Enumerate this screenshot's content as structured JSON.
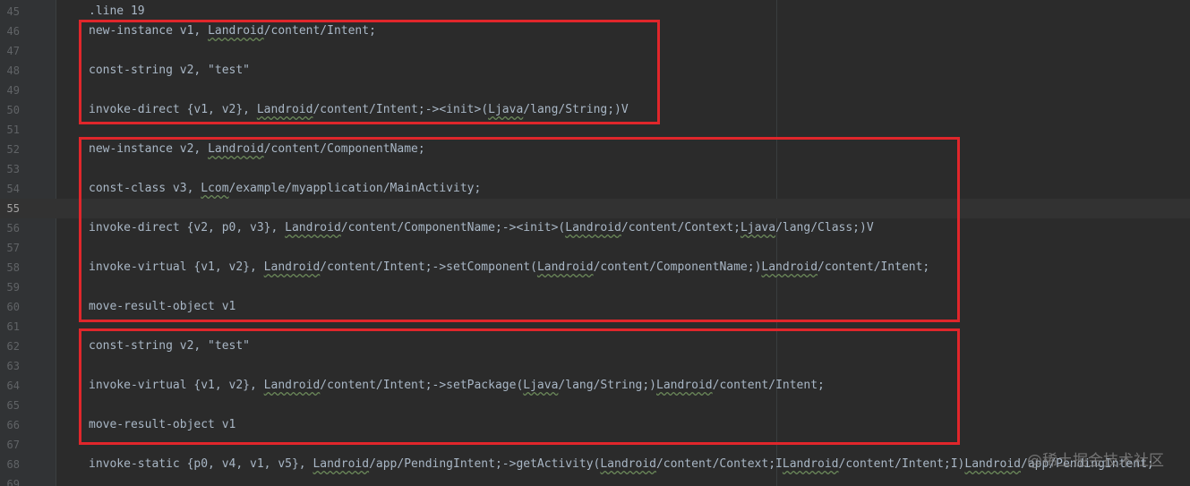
{
  "editor": {
    "lines": [
      {
        "num": "45",
        "parts": [
          {
            "t": ".line 19"
          }
        ]
      },
      {
        "num": "46",
        "parts": [
          {
            "t": "new-instance v1, "
          },
          {
            "t": "Landroid",
            "u": true
          },
          {
            "t": "/content/Intent;"
          }
        ]
      },
      {
        "num": "47",
        "parts": []
      },
      {
        "num": "48",
        "parts": [
          {
            "t": "const-string v2, \"test\""
          }
        ]
      },
      {
        "num": "49",
        "parts": []
      },
      {
        "num": "50",
        "parts": [
          {
            "t": "invoke-direct {v1, v2}, "
          },
          {
            "t": "Landroid",
            "u": true
          },
          {
            "t": "/content/Intent;->"
          },
          {
            "t": "<init>"
          },
          {
            "t": "("
          },
          {
            "t": "Ljava",
            "u": true
          },
          {
            "t": "/lang/String;)V"
          }
        ]
      },
      {
        "num": "51",
        "parts": []
      },
      {
        "num": "52",
        "parts": [
          {
            "t": "new-instance v2, "
          },
          {
            "t": "Landroid",
            "u": true
          },
          {
            "t": "/content/ComponentName;"
          }
        ]
      },
      {
        "num": "53",
        "parts": []
      },
      {
        "num": "54",
        "parts": [
          {
            "t": "const-class v3, "
          },
          {
            "t": "Lcom",
            "u": true
          },
          {
            "t": "/example/myapplication/MainActivity;"
          }
        ]
      },
      {
        "num": "55",
        "parts": [],
        "current": true
      },
      {
        "num": "56",
        "parts": [
          {
            "t": "invoke-direct {v2, p0, v3}, "
          },
          {
            "t": "Landroid",
            "u": true
          },
          {
            "t": "/content/ComponentName;->"
          },
          {
            "t": "<init>"
          },
          {
            "t": "("
          },
          {
            "t": "Landroid",
            "u": true
          },
          {
            "t": "/content/Context;"
          },
          {
            "t": "Ljava",
            "u": true
          },
          {
            "t": "/lang/Class;)V"
          }
        ]
      },
      {
        "num": "57",
        "parts": []
      },
      {
        "num": "58",
        "parts": [
          {
            "t": "invoke-virtual {v1, v2}, "
          },
          {
            "t": "Landroid",
            "u": true
          },
          {
            "t": "/content/Intent;->setComponent("
          },
          {
            "t": "Landroid",
            "u": true
          },
          {
            "t": "/content/ComponentName;)"
          },
          {
            "t": "Landroid",
            "u": true
          },
          {
            "t": "/content/Intent;"
          }
        ]
      },
      {
        "num": "59",
        "parts": []
      },
      {
        "num": "60",
        "parts": [
          {
            "t": "move-result-object v1"
          }
        ]
      },
      {
        "num": "61",
        "parts": []
      },
      {
        "num": "62",
        "parts": [
          {
            "t": "const-string v2, \"test\""
          }
        ]
      },
      {
        "num": "63",
        "parts": []
      },
      {
        "num": "64",
        "parts": [
          {
            "t": "invoke-virtual {v1, v2}, "
          },
          {
            "t": "Landroid",
            "u": true
          },
          {
            "t": "/content/Intent;->setPackage("
          },
          {
            "t": "Ljava",
            "u": true
          },
          {
            "t": "/lang/String;)"
          },
          {
            "t": "Landroid",
            "u": true
          },
          {
            "t": "/content/Intent;"
          }
        ]
      },
      {
        "num": "65",
        "parts": []
      },
      {
        "num": "66",
        "parts": [
          {
            "t": "move-result-object v1"
          }
        ]
      },
      {
        "num": "67",
        "parts": []
      },
      {
        "num": "68",
        "parts": [
          {
            "t": "invoke-static {p0, v4, v1, v5}, "
          },
          {
            "t": "Landroid",
            "u": true
          },
          {
            "t": "/app/PendingIntent;->getActivity("
          },
          {
            "t": "Landroid",
            "u": true
          },
          {
            "t": "/content/Context;I"
          },
          {
            "t": "Landroid",
            "u": true
          },
          {
            "t": "/content/Intent;I)"
          },
          {
            "t": "Landroid",
            "u": true
          },
          {
            "t": "/app/PendingIntent;"
          }
        ]
      },
      {
        "num": "69",
        "parts": []
      }
    ]
  },
  "colors": {
    "highlight_box": "#e0262b",
    "background": "#2b2b2b",
    "gutter": "#313335",
    "text": "#a9b7c6",
    "line_number": "#606366"
  },
  "watermark": {
    "text": "@稀土掘金技术社区"
  }
}
